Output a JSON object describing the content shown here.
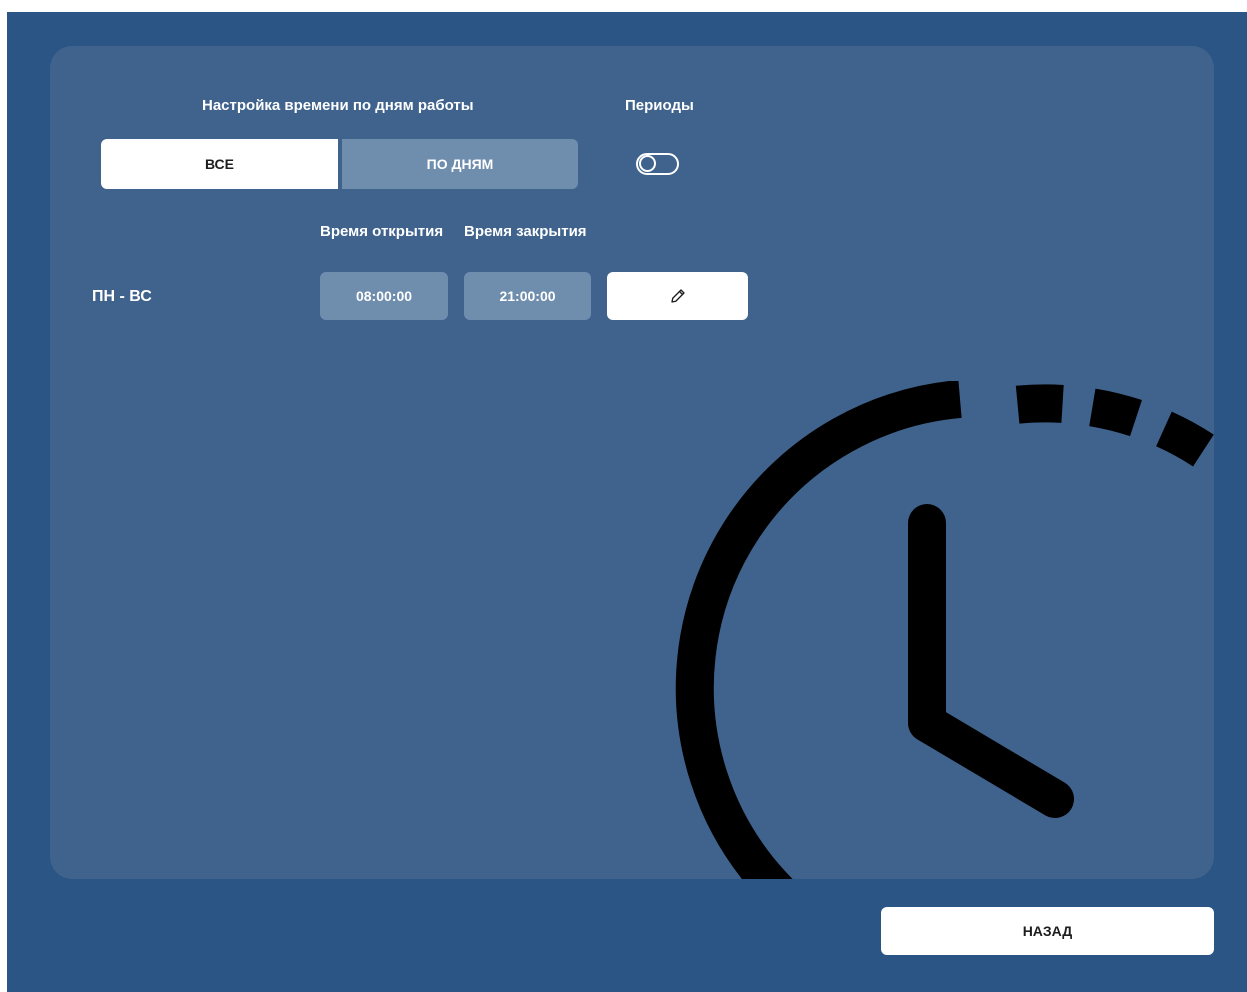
{
  "header": {
    "schedule_title": "Настройка времени по дням работы",
    "periods_title": "Периоды"
  },
  "mode_switch": {
    "all_label": "ВСЕ",
    "by_days_label": "ПО ДНЯМ",
    "selected": "ВСЕ"
  },
  "periods_toggle": {
    "state": "off"
  },
  "columns": {
    "open_time": "Время открытия",
    "close_time": "Время закрытия"
  },
  "schedule_rows": [
    {
      "days": "ПН - ВС",
      "open": "08:00:00",
      "close": "21:00:00"
    }
  ],
  "icons": {
    "edit": "pencil-icon",
    "decoration": "clock-icon"
  },
  "footer": {
    "back_label": "НАЗАД"
  },
  "colors": {
    "background": "#2a5584",
    "panel": "#3f638d",
    "field": "#6f8eae",
    "accent": "#ffffff"
  }
}
